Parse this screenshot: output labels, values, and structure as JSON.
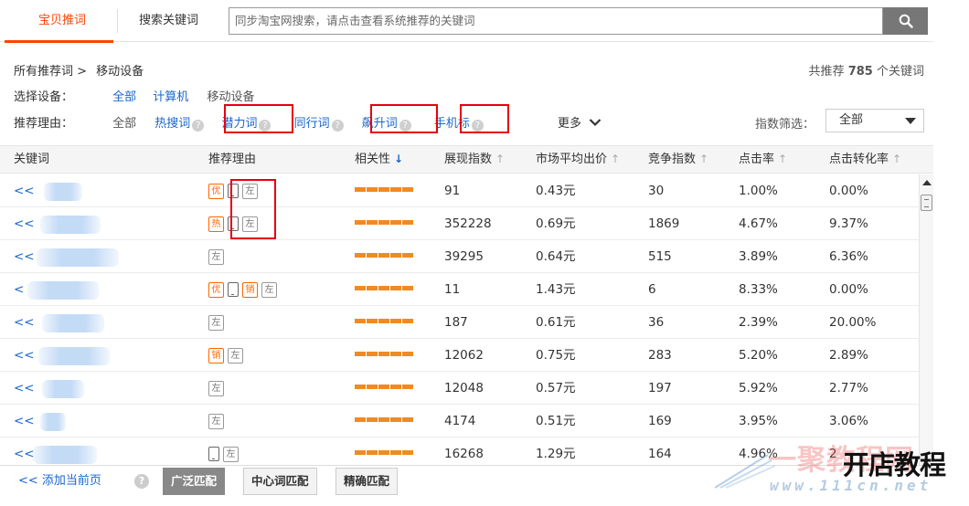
{
  "tabs": {
    "active": "宝贝推词",
    "search": "搜索关键词"
  },
  "search": {
    "placeholder": "同步淘宝网搜索，请点击查看系统推荐的关键词"
  },
  "breadcrumb": {
    "root": "所有推荐词 >",
    "current": "移动设备"
  },
  "summary": {
    "prefix": "共推荐",
    "count": "785",
    "suffix": "个关键词"
  },
  "device": {
    "label": "选择设备：",
    "options": [
      "全部",
      "计算机",
      "移动设备"
    ]
  },
  "reason": {
    "label": "推荐理由：",
    "all": "全部",
    "options": [
      "热搜词",
      "潜力词",
      "同行词",
      "飙升词",
      "手机标"
    ],
    "more": "更多"
  },
  "index_filter": {
    "label": "指数筛选：",
    "value": "全部"
  },
  "table": {
    "headers": [
      "关键词",
      "推荐理由",
      "相关性",
      "展现指数",
      "市场平均出价",
      "竞争指数",
      "点击率",
      "点击转化率"
    ],
    "rows": [
      {
        "kw": "<<",
        "badges": [
          "优",
          "phone",
          "左"
        ],
        "exp": "91",
        "price": "0.43元",
        "comp": "30",
        "ctr": "1.00%",
        "cvr": "0.00%"
      },
      {
        "kw": "<<",
        "badges": [
          "热",
          "phone",
          "左"
        ],
        "exp": "352228",
        "price": "0.69元",
        "comp": "1869",
        "ctr": "4.67%",
        "cvr": "9.37%"
      },
      {
        "kw": "<<",
        "badges": [
          "左"
        ],
        "exp": "39295",
        "price": "0.64元",
        "comp": "515",
        "ctr": "3.89%",
        "cvr": "6.36%"
      },
      {
        "kw": "<",
        "badges": [
          "优",
          "phone",
          "销",
          "左"
        ],
        "exp": "11",
        "price": "1.43元",
        "comp": "6",
        "ctr": "8.33%",
        "cvr": "0.00%"
      },
      {
        "kw": "<<",
        "badges": [
          "左"
        ],
        "exp": "187",
        "price": "0.61元",
        "comp": "36",
        "ctr": "2.39%",
        "cvr": "20.00%"
      },
      {
        "kw": "<<",
        "badges": [
          "销",
          "左"
        ],
        "exp": "12062",
        "price": "0.75元",
        "comp": "283",
        "ctr": "5.20%",
        "cvr": "2.89%"
      },
      {
        "kw": "<<",
        "badges": [
          "左"
        ],
        "exp": "12048",
        "price": "0.57元",
        "comp": "197",
        "ctr": "5.92%",
        "cvr": "2.77%"
      },
      {
        "kw": "<<",
        "badges": [
          "左"
        ],
        "exp": "4174",
        "price": "0.51元",
        "comp": "169",
        "ctr": "3.95%",
        "cvr": "3.06%"
      },
      {
        "kw": "<<",
        "badges": [
          "phone",
          "左"
        ],
        "exp": "16268",
        "price": "1.29元",
        "comp": "164",
        "ctr": "4.96%",
        "cvr": "2"
      }
    ]
  },
  "footer": {
    "add_page": "<< 添加当前页",
    "match": [
      "广泛匹配",
      "中心词匹配",
      "精确匹配"
    ]
  },
  "watermark": {
    "cn": "一聚教程网",
    "big": "开店教程",
    "url": "www.111cn.net"
  },
  "colors": {
    "accent": "#ff4400",
    "link": "#1a66cc",
    "highlight_box": "#e60012",
    "relevance_bar": "#f08a24"
  }
}
